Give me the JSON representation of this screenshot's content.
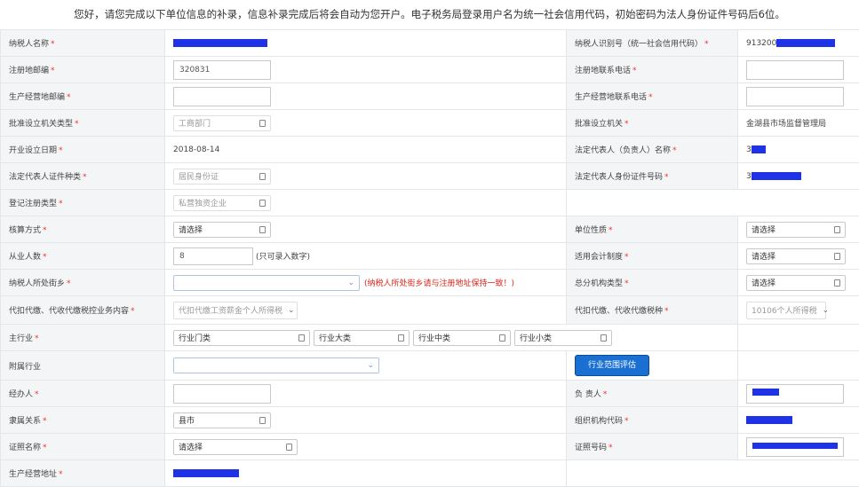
{
  "notice": "您好，请您完成以下单位信息的补录，信息补录完成后将会自动为您开户。电子税务局登录用户名为统一社会信用代码，初始密码为法人身份证件号码后6位。",
  "labels": {
    "taxpayer_name": "纳税人名称",
    "taxpayer_id": "纳税人识别号（统一社会信用代码）",
    "reg_postcode": "注册地邮编",
    "reg_phone": "注册地联系电话",
    "biz_postcode": "生产经营地邮编",
    "biz_phone": "生产经营地联系电话",
    "approval_type": "批准设立机关类型",
    "approval_org": "批准设立机关",
    "open_date": "开业设立日期",
    "legal_name": "法定代表人（负责人）名称",
    "legal_id_type": "法定代表人证件种类",
    "legal_id_no": "法定代表人身份证件号码",
    "reg_type": "登记注册类型",
    "accounting": "核算方式",
    "unit_nature": "单位性质",
    "employees": "从业人数",
    "acct_system": "适用会计制度",
    "street": "纳税人所处街乡",
    "branch_type": "总分机构类型",
    "withhold_content": "代扣代缴、代收代缴税控业务内容",
    "withhold_tax": "代扣代缴、代收代缴税种",
    "main_industry": "主行业",
    "sub_industry": "附属行业",
    "handler": "经办人",
    "person_in_charge": "负 责人",
    "affiliation": "隶属关系",
    "org_code": "组织机构代码",
    "cert_name": "证照名称",
    "cert_no": "证照号码",
    "biz_address": "生产经营地址"
  },
  "required_mark": "*",
  "values": {
    "taxpayer_id_prefix": "913200",
    "reg_postcode": "320831",
    "reg_phone": "",
    "biz_postcode": "",
    "biz_phone": "",
    "approval_type": "工商部门",
    "approval_org": "金湖县市场监督管理局",
    "open_date": "2018-08-14",
    "legal_id_type": "居民身份证",
    "reg_type": "私营独资企业",
    "accounting": "请选择",
    "unit_nature": "请选择",
    "employees": "8",
    "employees_hint": "(只可录入数字)",
    "acct_system": "请选择",
    "street": "",
    "street_note": "(纳税人所处街乡请与注册地址保持一致！)",
    "branch_type": "请选择",
    "withhold_content": "代扣代缴工资薪金个人所得税",
    "withhold_tax": "10106个人所得税",
    "industry_category": "行业门类",
    "industry_major": "行业大类",
    "industry_middle": "行业中类",
    "industry_minor": "行业小类",
    "sub_industry": "",
    "scope_button": "行业范围评估",
    "handler": "",
    "affiliation": "县市",
    "cert_name": "请选择",
    "legal_id_prefix": "3",
    "legal_name_prefix": "3"
  },
  "colors": {
    "mask": "#1f33e6",
    "required": "#e33333",
    "note": "#e0231c",
    "button": "#1a6fd2",
    "label_bg": "#f4f5f7"
  }
}
